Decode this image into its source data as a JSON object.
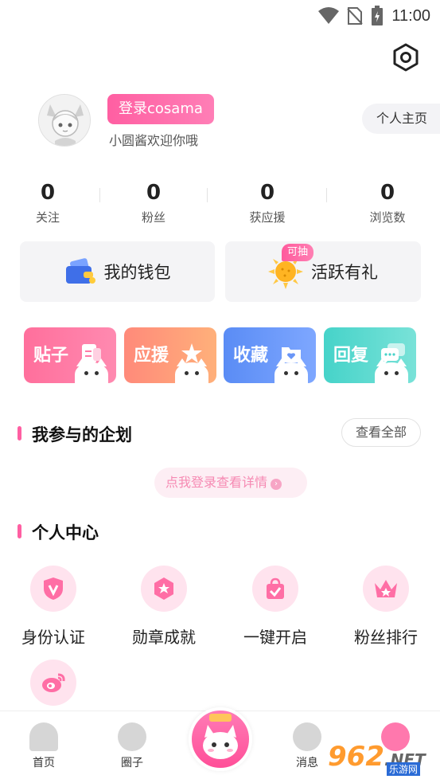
{
  "status_bar": {
    "time": "11:00"
  },
  "profile": {
    "login_label": "登录cosama",
    "welcome_text": "小圆酱欢迎你哦",
    "homepage_label": "个人主页"
  },
  "stats": [
    {
      "value": "0",
      "label": "关注"
    },
    {
      "value": "0",
      "label": "粉丝"
    },
    {
      "value": "0",
      "label": "获应援"
    },
    {
      "value": "0",
      "label": "浏览数"
    }
  ],
  "cards": {
    "wallet_label": "我的钱包",
    "active_label": "活跃有礼",
    "active_badge": "可抽"
  },
  "tiles": [
    {
      "label": "贴子",
      "color_from": "#ff6f9c",
      "color_to": "#ff8ab0"
    },
    {
      "label": "应援",
      "color_from": "#ff8a7a",
      "color_to": "#ffb07a"
    },
    {
      "label": "收藏",
      "color_from": "#5a8cf5",
      "color_to": "#7ea7ff"
    },
    {
      "label": "回复",
      "color_from": "#46d3c9",
      "color_to": "#79e2d8"
    }
  ],
  "plans": {
    "title": "我参与的企划",
    "view_all": "查看全部",
    "login_prompt": "点我登录查看详情"
  },
  "personal_center": {
    "title": "个人中心",
    "items": [
      {
        "label": "身份认证",
        "icon": "shield-v-icon"
      },
      {
        "label": "勋章成就",
        "icon": "badge-star-icon"
      },
      {
        "label": "一键开启",
        "icon": "bag-check-icon"
      },
      {
        "label": "粉丝排行",
        "icon": "crown-icon"
      },
      {
        "label": "",
        "icon": "weibo-icon"
      }
    ]
  },
  "bottom_nav": {
    "items": [
      {
        "label": "首页"
      },
      {
        "label": "圈子"
      },
      {
        "label": "消息"
      }
    ]
  },
  "watermark": {
    "text": "962",
    "net": ".NET",
    "sub": "乐游网"
  },
  "colors": {
    "accent": "#ff5fa2",
    "card_bg": "#f4f4f6"
  }
}
